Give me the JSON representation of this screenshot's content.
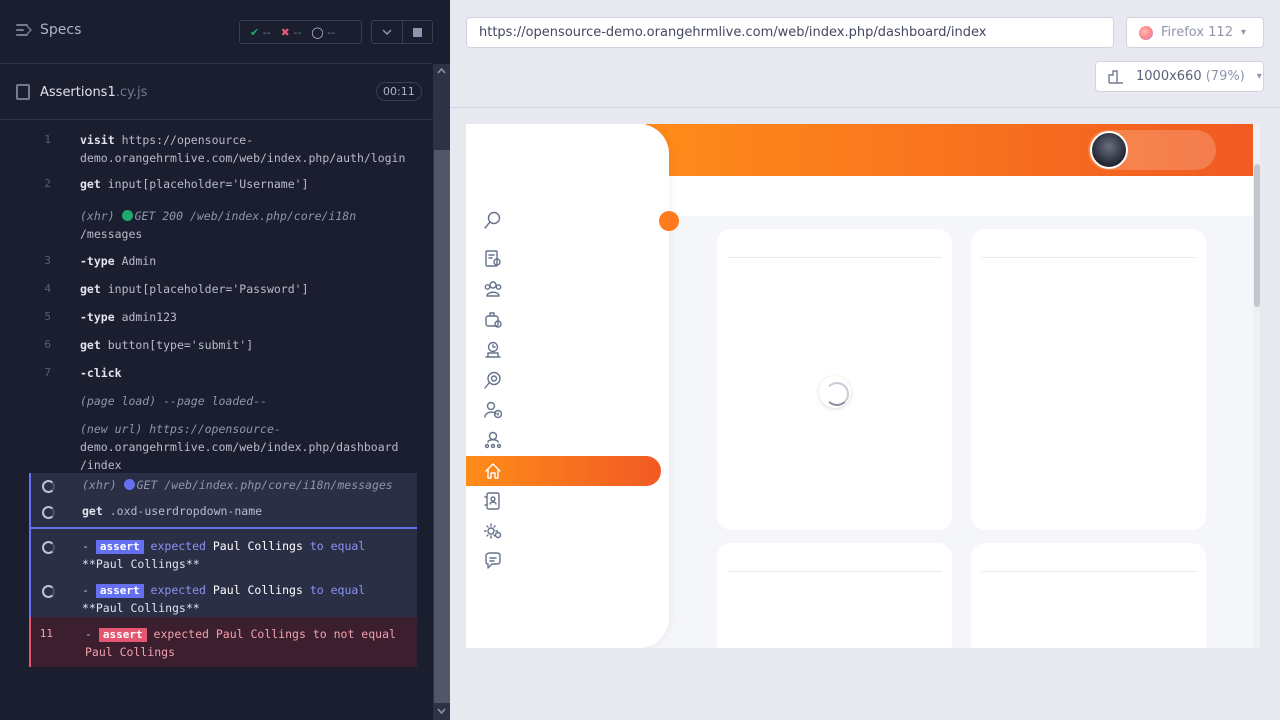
{
  "specs": {
    "title": "Specs",
    "stats": {
      "passed": "--",
      "failed": "--",
      "pending": "--"
    }
  },
  "file": {
    "name": "Assertions1",
    "ext": ".cy.js",
    "duration": "00:11"
  },
  "commands": [
    {
      "num": "1",
      "name": "visit",
      "msg": "https://opensource-",
      "msg2": "demo.orangehrmlive.com/web/index.php/auth/login"
    },
    {
      "num": "2",
      "name": "get",
      "msg": "input[placeholder='Username']"
    },
    {
      "tag": "(xhr)",
      "msg": "GET 200 /web/index.php/core/i18n",
      "msg2": "/messages",
      "dot": "#1fa971"
    },
    {
      "num": "3",
      "name": "-type",
      "msg": "Admin"
    },
    {
      "num": "4",
      "name": "get",
      "msg": "input[placeholder='Password']"
    },
    {
      "num": "5",
      "name": "-type",
      "msg": "admin123"
    },
    {
      "num": "6",
      "name": "get",
      "msg": "button[type='submit']"
    },
    {
      "num": "7",
      "name": "-click",
      "msg": ""
    },
    {
      "tag": "(page load)",
      "msg": "--page loaded--"
    },
    {
      "tag": "(new url)",
      "msg": "https://opensource-",
      "msg2": "demo.orangehrmlive.com/web/index.php/dashboard",
      "msg3": "/index"
    },
    {
      "tag": "(xhr)",
      "msg": "GET /web/index.php/core/i18n/messages",
      "dot": "#6470f0"
    },
    {
      "name": "get",
      "msg": ".oxd-userdropdown-name"
    },
    {
      "badge": "assert",
      "msg_a": "expected",
      "msg_b": "Paul Collings",
      "msg_c": "to equal",
      "msg2": "**Paul Collings**"
    },
    {
      "badge": "assert",
      "msg_a": "expected",
      "msg_b": "Paul Collings",
      "msg_c": "to equal",
      "msg2": "**Paul Collings**"
    },
    {
      "num": "11",
      "badge": "assert",
      "msg_a": "expected",
      "msg_b": "Paul Collings",
      "msg_c": "to not equal",
      "msg2": "Paul Collings"
    }
  ],
  "browser": {
    "url": "https://opensource-demo.orangehrmlive.com/web/index.php/dashboard/index",
    "name": "Firefox 112",
    "viewport": "1000x660",
    "zoom": "(79%)"
  },
  "sidebar_icons": [
    "search-icon",
    "admin-icon",
    "pim-icon",
    "leave-icon",
    "time-icon",
    "recruitment-icon",
    "my-info-icon",
    "performance-icon",
    "dashboard-icon",
    "directory-icon",
    "maintenance-icon",
    "buzz-icon"
  ],
  "colors": {
    "accent": "#ff7b1d",
    "assert": "#6470f0",
    "fail": "#e45770",
    "pass": "#1fa971"
  }
}
